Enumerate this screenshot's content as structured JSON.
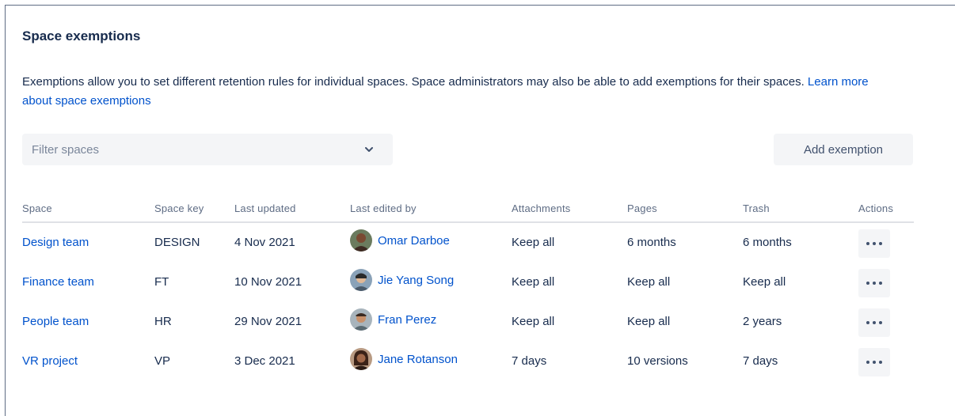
{
  "title": "Space exemptions",
  "description": {
    "text": "Exemptions allow you to set different retention rules for individual spaces. Space administrators may also be able to add exemptions for their spaces. ",
    "link": "Learn more about space exemptions"
  },
  "filter": {
    "placeholder": "Filter spaces",
    "icon": "chevron-down-icon"
  },
  "add_button": "Add exemption",
  "table": {
    "headers": {
      "space": "Space",
      "key": "Space key",
      "updated": "Last updated",
      "edited": "Last edited by",
      "attachments": "Attachments",
      "pages": "Pages",
      "trash": "Trash",
      "actions": "Actions"
    },
    "rows": [
      {
        "space": "Design team",
        "key": "DESIGN",
        "updated": "4 Nov 2021",
        "edited": "Omar Darboe",
        "attachments": "Keep all",
        "pages": "6 months",
        "trash": "6 months"
      },
      {
        "space": "Finance team",
        "key": "FT",
        "updated": "10 Nov 2021",
        "edited": "Jie Yang Song",
        "attachments": "Keep all",
        "pages": "Keep all",
        "trash": "Keep all"
      },
      {
        "space": "People team",
        "key": "HR",
        "updated": "29 Nov 2021",
        "edited": "Fran Perez",
        "attachments": "Keep all",
        "pages": "Keep all",
        "trash": "2 years"
      },
      {
        "space": "VR project",
        "key": "VP",
        "updated": "3 Dec 2021",
        "edited": "Jane Rotanson",
        "attachments": "7 days",
        "pages": "10 versions",
        "trash": "7 days"
      }
    ]
  },
  "colors": {
    "link": "#0052cc",
    "text": "#172b4d",
    "subtle": "#5e6c84",
    "button_bg": "#f4f5f7"
  }
}
